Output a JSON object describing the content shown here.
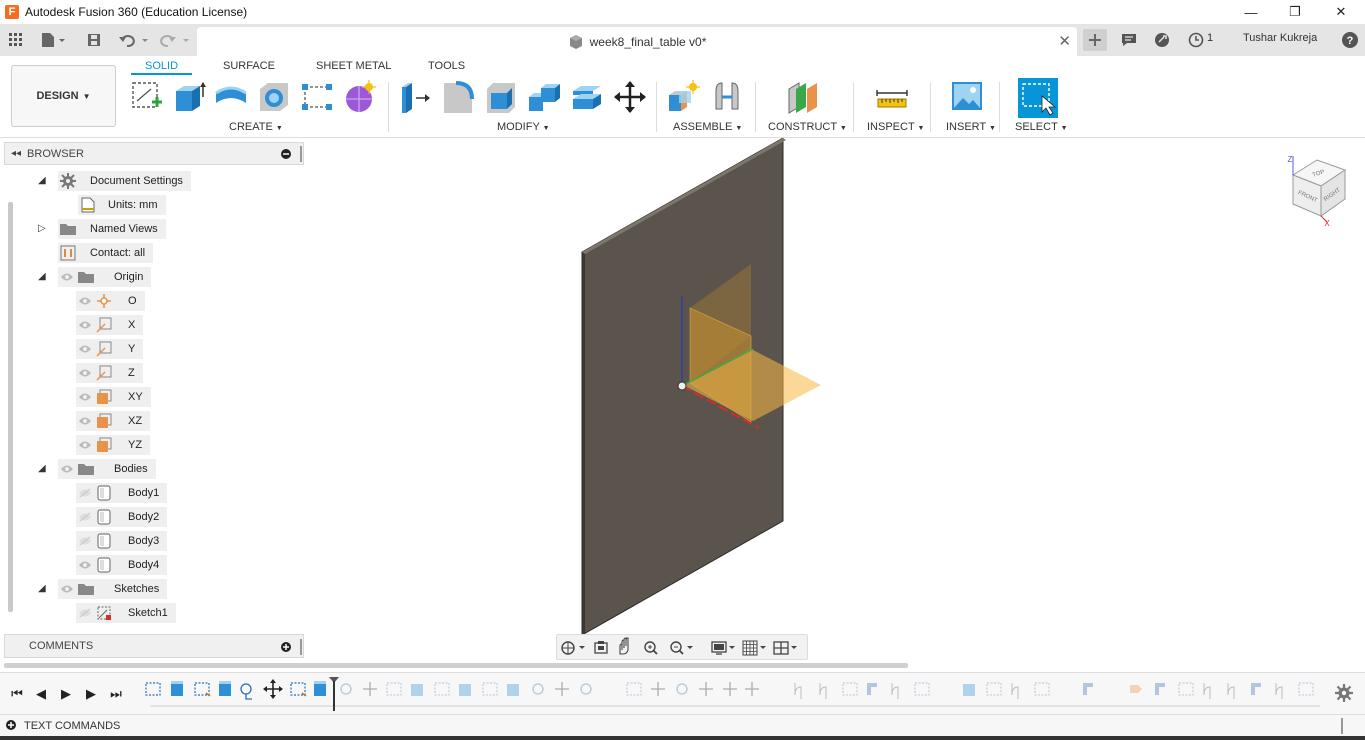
{
  "window": {
    "title": "Autodesk Fusion 360 (Education License)",
    "logo_letter": "F",
    "minimize": "—",
    "restore": "❐",
    "close": "✕"
  },
  "tabbar": {
    "document_title": "week8_final_table v0*",
    "job_count": "1",
    "user_name": "Tushar Kukreja"
  },
  "toolbar": {
    "workspace": "DESIGN",
    "tabs": [
      "SOLID",
      "SURFACE",
      "SHEET METAL",
      "TOOLS"
    ],
    "active_tab": "SOLID",
    "groups": {
      "create": "CREATE",
      "modify": "MODIFY",
      "assemble": "ASSEMBLE",
      "construct": "CONSTRUCT",
      "inspect": "INSPECT",
      "insert": "INSERT",
      "select": "SELECT"
    }
  },
  "browser": {
    "title": "BROWSER",
    "items": {
      "document_settings": "Document Settings",
      "units": "Units: mm",
      "named_views": "Named Views",
      "contact": "Contact: all",
      "origin": "Origin",
      "o": "O",
      "x": "X",
      "y": "Y",
      "z": "Z",
      "xy": "XY",
      "xz": "XZ",
      "yz": "YZ",
      "bodies": "Bodies",
      "body1": "Body1",
      "body2": "Body2",
      "body3": "Body3",
      "body4": "Body4",
      "sketches": "Sketches",
      "sketch1": "Sketch1"
    }
  },
  "comments": {
    "title": "COMMENTS"
  },
  "viewcube": {
    "top": "TOP",
    "front": "FRONT",
    "right": "RIGHT",
    "z": "Z",
    "x": "X"
  },
  "text_commands": {
    "title": "TEXT COMMANDS"
  },
  "colors": {
    "accent": "#0696d7",
    "body": "#5a544c",
    "origin_plane": "#f7b844",
    "axis_x": "#d62c2c",
    "axis_y": "#3aa84a",
    "axis_z": "#2b3fb3"
  }
}
